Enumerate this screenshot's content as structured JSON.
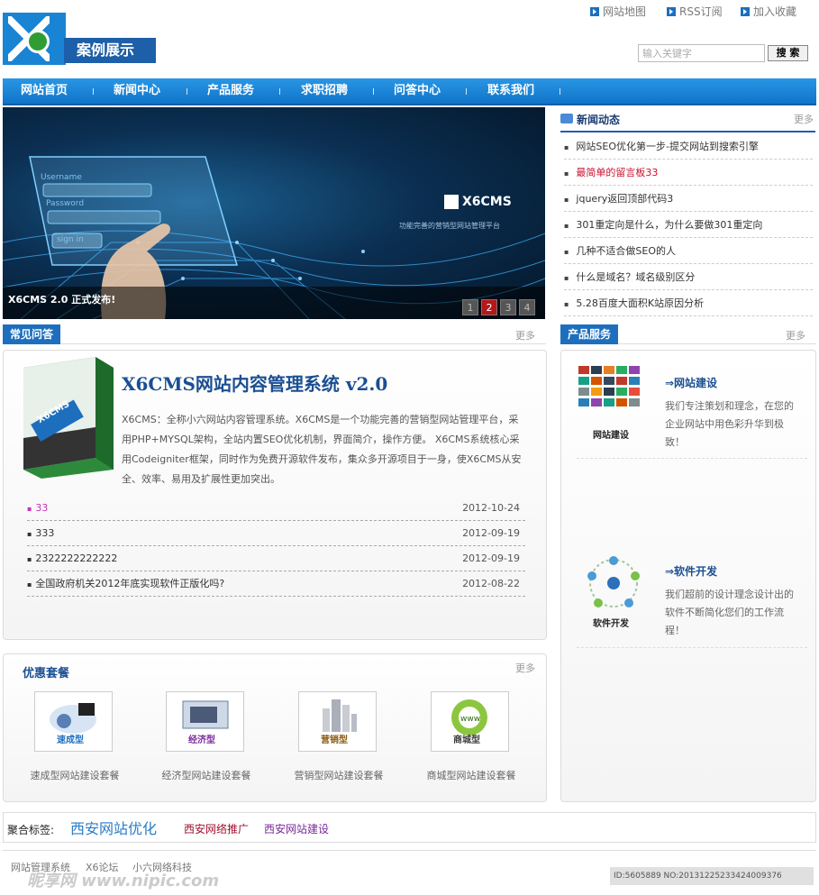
{
  "header": {
    "logo_text": "案例展示",
    "top_links": [
      "网站地图",
      "RSS订阅",
      "加入收藏"
    ],
    "search_placeholder": "输入关键字",
    "search_button": "搜 索"
  },
  "nav": [
    "网站首页",
    "新闻中心",
    "产品服务",
    "求职招聘",
    "问答中心",
    "联系我们"
  ],
  "banner": {
    "caption": "X6CMS 2.0 正式发布!",
    "brand": "X6CMS",
    "brand_sub": "功能完善的营销型网站管理平台",
    "login_labels": [
      "Username",
      "Password",
      "sign in"
    ],
    "pages": [
      "1",
      "2",
      "3",
      "4"
    ],
    "active_page": 2
  },
  "news": {
    "title": "新闻动态",
    "more": "更多",
    "items": [
      "网站SEO优化第一步-提交网站到搜索引擎",
      "最简单的留言板33",
      "jquery返回顶部代码3",
      "301重定向是什么，为什么要做301重定向",
      "几种不适合做SEO的人",
      "什么是域名？域名级别区分",
      "5.28百度大面积K站原因分析"
    ],
    "highlight_index": 1
  },
  "faq": {
    "tab": "常见问答",
    "more": "更多",
    "box_label": "X6CMS",
    "headline": "X6CMS网站内容管理系统  v2.0",
    "description": "X6CMS：全称小六网站内容管理系统。X6CMS是一个功能完善的营销型网站管理平台，采用PHP+MYSQL架构，全站内置SEO优化机制，界面简介，操作方便。 X6CMS系统核心采用Codeigniter框架，同时作为免费开源软件发布，集众多开源项目于一身，使X6CMS从安全、效率、易用及扩展性更加突出。",
    "rows": [
      {
        "title": "33",
        "date": "2012-10-24"
      },
      {
        "title": "333",
        "date": "2012-09-19"
      },
      {
        "title": "2322222222222",
        "date": "2012-09-19"
      },
      {
        "title": "全国政府机关2012年底实现软件正版化吗?",
        "date": "2012-08-22"
      }
    ]
  },
  "packages": {
    "title": "优惠套餐",
    "more": "更多",
    "items": [
      {
        "label": "速成型网站建设套餐",
        "badge": "速成型",
        "color": "#1f6fc0"
      },
      {
        "label": "经济型网站建设套餐",
        "badge": "经济型",
        "color": "#7a2a9a"
      },
      {
        "label": "营销型网站建设套餐",
        "badge": "营销型",
        "color": "#8a5a10"
      },
      {
        "label": "商城型网站建设套餐",
        "badge": "商城型",
        "color": "#3a3a3a"
      }
    ]
  },
  "services": {
    "tab": "产品服务",
    "more": "更多",
    "items": [
      {
        "title": "⇒网站建设",
        "desc": "我们专注策划和理念，在您的企业网站中用色彩升华到极致！",
        "caption": "网站建设"
      },
      {
        "title": "⇒软件开发",
        "desc": "我们超前的设计理念设计出的软件不断简化您们的工作流程！",
        "caption": "软件开发"
      }
    ]
  },
  "tags": {
    "label": "聚合标签:",
    "items": [
      "西安网站优化",
      "西安网络推广",
      "西安网站建设"
    ]
  },
  "footer": {
    "links": [
      "网站管理系统",
      "X6论坛",
      "小六网络科技"
    ],
    "watermark": "昵享网 www.nipic.com",
    "id_text": "ID:5605889 NO:20131225233424009376"
  }
}
